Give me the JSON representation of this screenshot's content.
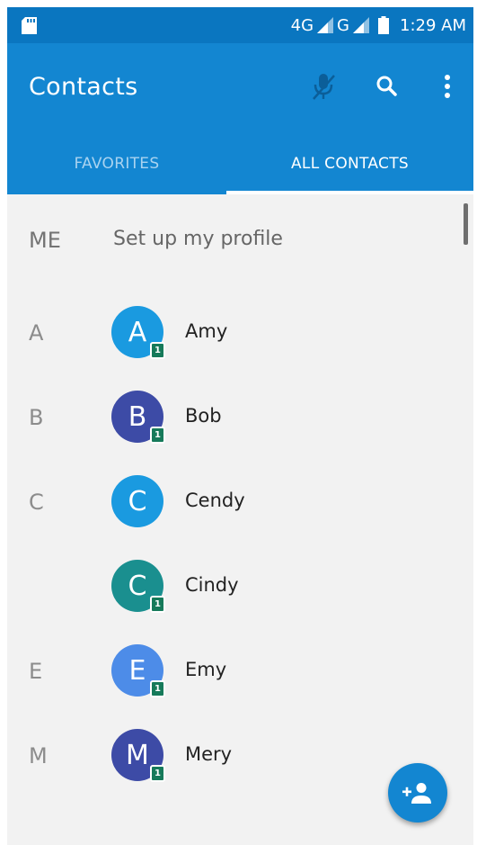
{
  "status_bar": {
    "network_4g": "4G",
    "network_g": "G",
    "time": "1:29 AM"
  },
  "app_bar": {
    "title": "Contacts",
    "icons": [
      "mic-off-icon",
      "search-icon",
      "more-vert-icon"
    ]
  },
  "tabs": [
    {
      "label": "FAVORITES",
      "selected": false
    },
    {
      "label": "ALL CONTACTS",
      "selected": true
    }
  ],
  "me_row": {
    "letter": "ME",
    "text": "Set up my profile"
  },
  "contacts": [
    {
      "section": "A",
      "initial": "A",
      "name": "Amy",
      "color": "#1a9ae0",
      "sim": "1",
      "sim_badge": true
    },
    {
      "section": "B",
      "initial": "B",
      "name": "Bob",
      "color": "#3d4ba6",
      "sim": "1",
      "sim_badge": true
    },
    {
      "section": "C",
      "initial": "C",
      "name": "Cendy",
      "color": "#1a9ae0",
      "sim": "",
      "sim_badge": false
    },
    {
      "section": "",
      "initial": "C",
      "name": "Cindy",
      "color": "#1a8f8f",
      "sim": "1",
      "sim_badge": true
    },
    {
      "section": "E",
      "initial": "E",
      "name": "Emy",
      "color": "#4d8ce8",
      "sim": "1",
      "sim_badge": true
    },
    {
      "section": "M",
      "initial": "M",
      "name": "Mery",
      "color": "#3d4ba6",
      "sim": "1",
      "sim_badge": true
    }
  ],
  "fab": {
    "icon": "add-contact-icon"
  },
  "colors": {
    "app_bar": "#1386d1",
    "status_bar": "#0a76c0",
    "list_background": "#f2f2f2"
  }
}
